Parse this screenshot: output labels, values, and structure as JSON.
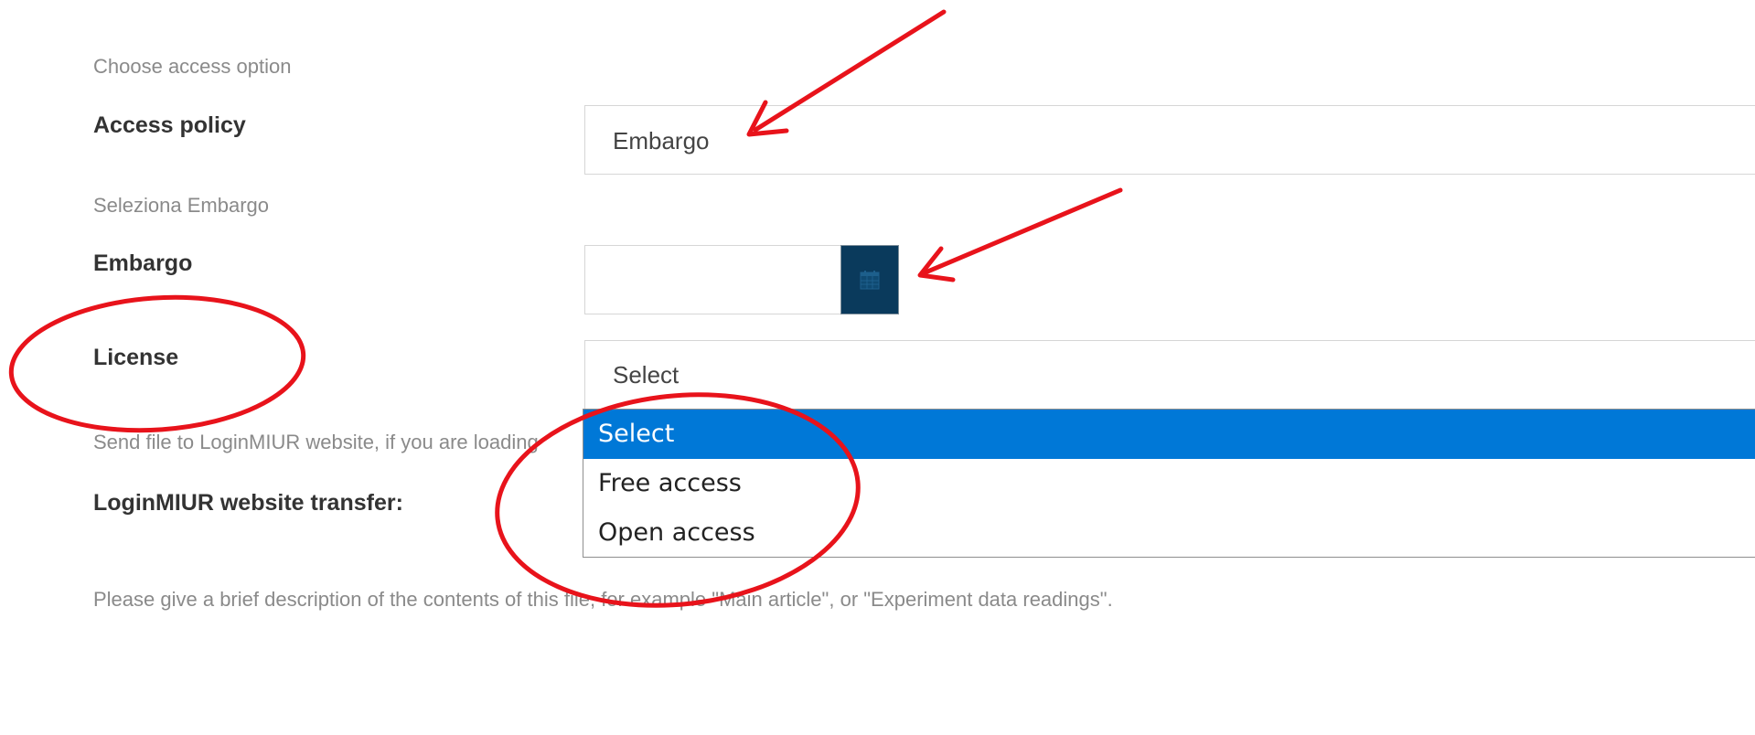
{
  "form": {
    "access": {
      "hint": "Choose access option",
      "label": "Access policy",
      "value": "Embargo"
    },
    "embargo": {
      "hint": "Seleziona Embargo",
      "label": "Embargo",
      "date_value": "",
      "calendar_icon": "calendar-icon"
    },
    "license": {
      "label": "License",
      "selected_value": "Select",
      "options": [
        "Select",
        "Free access",
        "Open access"
      ],
      "highlighted_index": 0
    },
    "transfer": {
      "hint": "Send file to LoginMIUR website, if you are loading",
      "label": "LoginMIUR website transfer:"
    },
    "description": {
      "hint": "Please give a brief description of the contents of this file, for example \"Main article\", or \"Experiment data readings\"."
    }
  },
  "annotations": {
    "color": "#e8131b",
    "arrows": 2,
    "ellipses": 2
  }
}
